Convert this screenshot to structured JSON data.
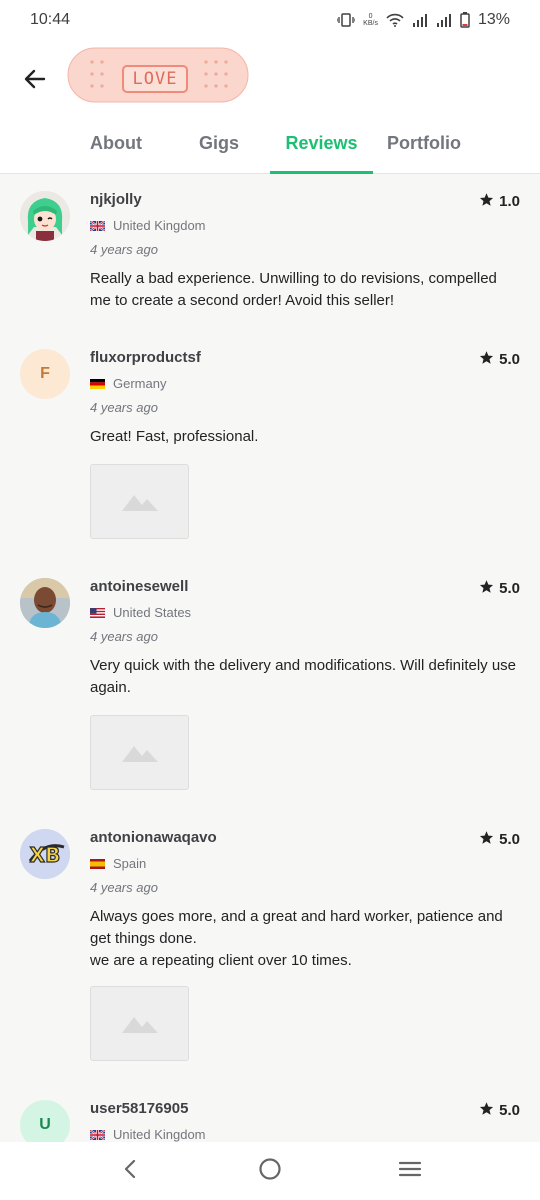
{
  "status_bar": {
    "time": "10:44",
    "net_speed_value": "0",
    "net_speed_unit": "KB/s",
    "battery": "13%",
    "icons": [
      "vibrate-icon",
      "wifi-icon",
      "signal-icon",
      "signal-icon",
      "battery-icon"
    ]
  },
  "header": {
    "logo_text": "LOVE",
    "back_icon": "arrow-left-icon"
  },
  "tabs": [
    {
      "label": "About",
      "active": false
    },
    {
      "label": "Gigs",
      "active": false
    },
    {
      "label": "Reviews",
      "active": true
    },
    {
      "label": "Portfolio",
      "active": false
    }
  ],
  "reviews": [
    {
      "username": "njkjolly",
      "rating": "1.0",
      "country": "United Kingdom",
      "time": "4 years ago",
      "text": "Really a bad experience. Unwilling to do revisions, compelled me to create a second order! Avoid this seller!",
      "avatar": "anime-character-avatar",
      "has_attachment": false
    },
    {
      "username": "fluxorproductsf",
      "rating": "5.0",
      "country": "Germany",
      "time": "4 years ago",
      "text": "Great! Fast, professional.",
      "avatar_initial": "F",
      "has_attachment": true
    },
    {
      "username": "antoinesewell",
      "rating": "5.0",
      "country": "United States",
      "time": "4 years ago",
      "text": "Very quick with the delivery and modifications. Will definitely use again.",
      "avatar": "photo-avatar",
      "has_attachment": true
    },
    {
      "username": "antonionawaqavo",
      "rating": "5.0",
      "country": "Spain",
      "time": "4 years ago",
      "text": "Always goes more, and a great and hard worker, patience and get things done.\nwe are a repeating client over 10 times.",
      "avatar_text": "XB",
      "has_attachment": true
    },
    {
      "username": "user58176905",
      "rating": "5.0",
      "country": "United Kingdom",
      "avatar_initial": "U",
      "has_attachment": false
    }
  ],
  "colors": {
    "accent": "#1dbf73",
    "text": "#222325",
    "muted": "#74767e",
    "background": "#f7f7f5"
  },
  "nav_bar": {
    "icons": [
      "back-nav-icon",
      "home-nav-icon",
      "recents-nav-icon"
    ]
  }
}
